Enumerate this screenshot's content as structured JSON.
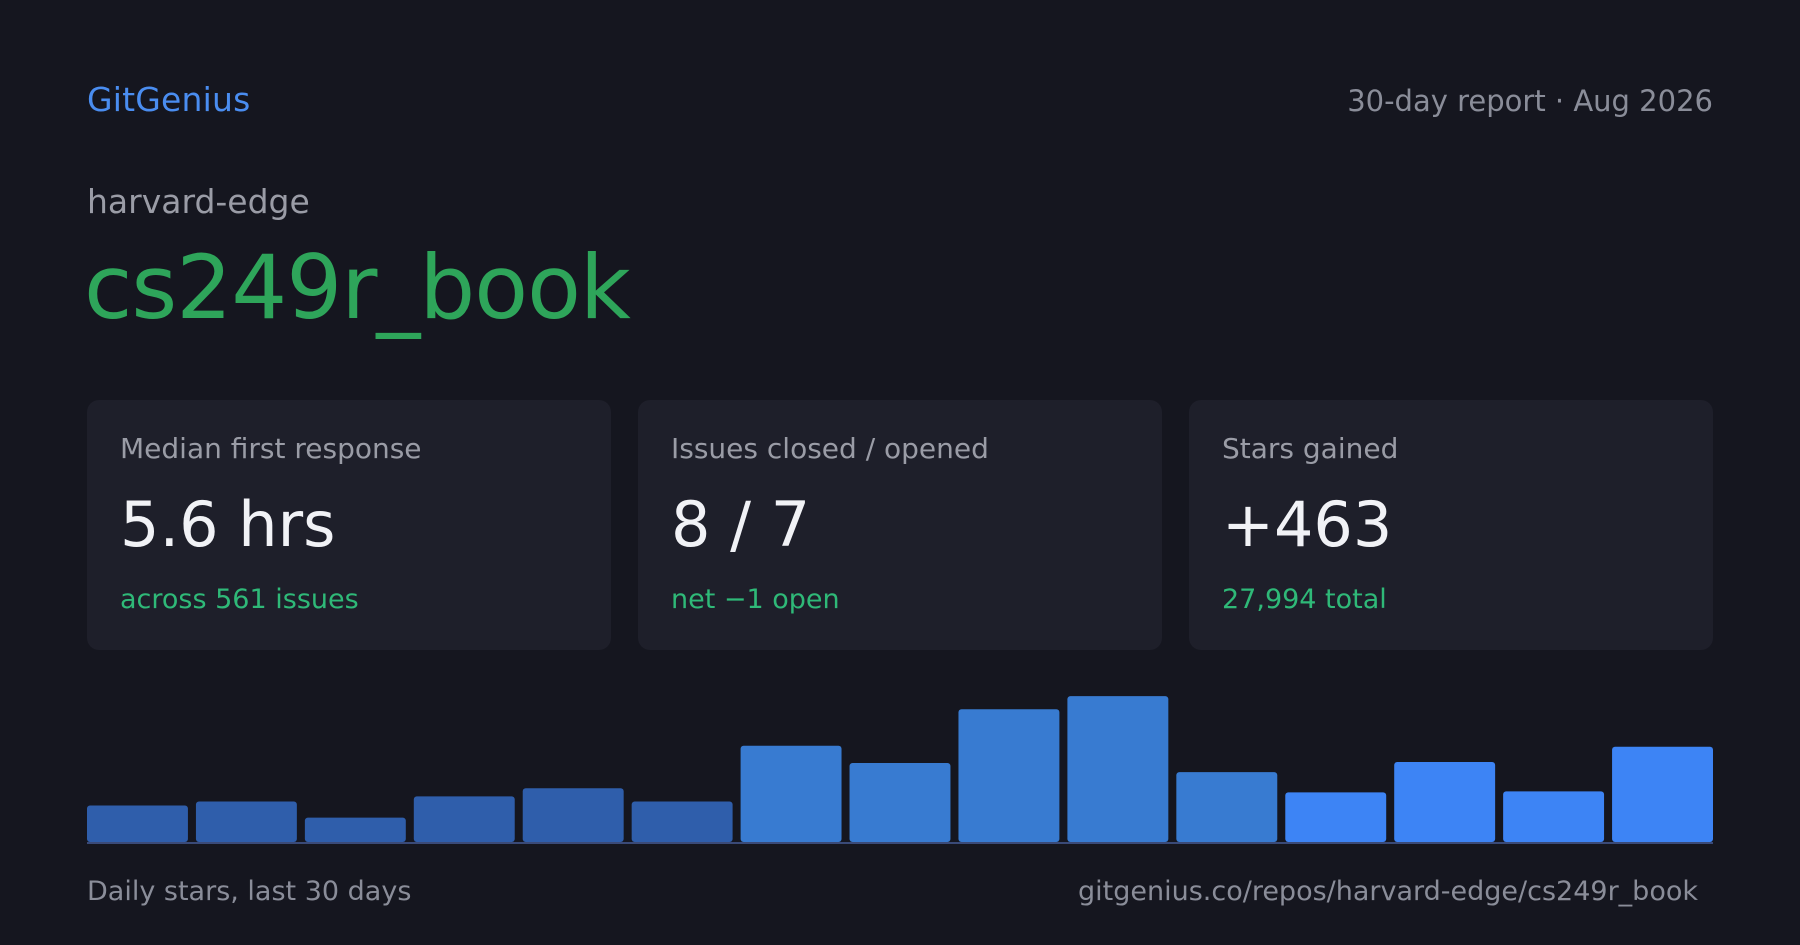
{
  "header": {
    "brand": "GitGenius",
    "report": "30-day report · Aug 2026"
  },
  "repo": {
    "owner": "harvard-edge",
    "name": "cs249r_book"
  },
  "cards": [
    {
      "label": "Median first response",
      "value": "5.6 hrs",
      "sub": "across 561 issues"
    },
    {
      "label": "Issues closed / opened",
      "value": "8 / 7",
      "sub": "net −1 open"
    },
    {
      "label": "Stars gained",
      "value": "+463",
      "sub": "27,994 total"
    }
  ],
  "colors": {
    "background": "#15161f",
    "brand": "#4a8df0",
    "repo": "#2ea55a",
    "positive": "#2fb978",
    "bar_dark": "#2f5eab",
    "bar_mid": "#387bd1",
    "bar_bright": "#3d84f5"
  },
  "chart_data": {
    "type": "bar",
    "caption": "Daily stars, last 30 days",
    "values": [
      36,
      40,
      24,
      45,
      53,
      40,
      95,
      78,
      131,
      144,
      69,
      49,
      79,
      50,
      94
    ],
    "color_groups": [
      "bar_dark",
      "bar_dark",
      "bar_dark",
      "bar_dark",
      "bar_dark",
      "bar_dark",
      "bar_mid",
      "bar_mid",
      "bar_mid",
      "bar_mid",
      "bar_mid",
      "bar_bright",
      "bar_bright",
      "bar_bright",
      "bar_bright"
    ],
    "ylim": [
      0,
      150
    ],
    "grid": false,
    "legend": "none"
  },
  "footer": {
    "url": "gitgenius.co/repos/harvard-edge/cs249r_book"
  }
}
